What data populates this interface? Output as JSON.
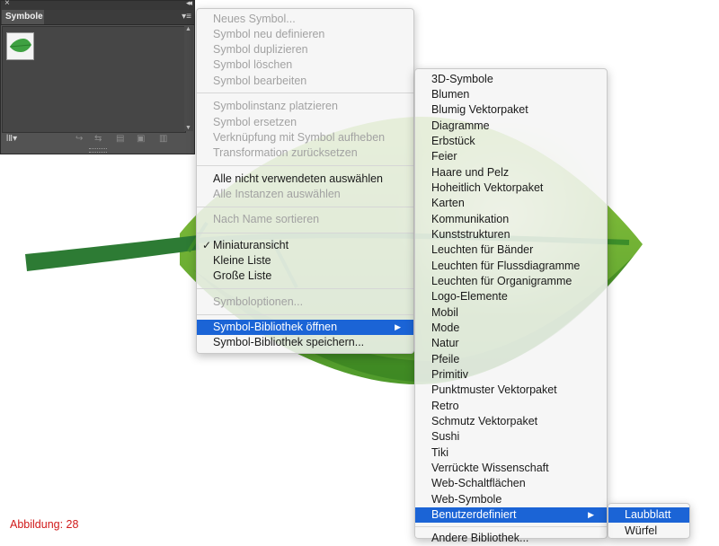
{
  "panel": {
    "tab_title": "Symbole",
    "close_glyph": "×",
    "collapse_glyph": "◂◂",
    "menu_glyph": "▾≡",
    "library_glyph": "lⅡ▾"
  },
  "context_menu": {
    "items": [
      "Neues Symbol...",
      "Symbol neu definieren",
      "Symbol duplizieren",
      "Symbol löschen",
      "Symbol bearbeiten",
      "Symbolinstanz platzieren",
      "Symbol ersetzen",
      "Verknüpfung mit Symbol aufheben",
      "Transformation zurücksetzen",
      "Alle nicht verwendeten auswählen",
      "Alle Instanzen auswählen",
      "Nach Name sortieren",
      "Miniaturansicht",
      "Kleine Liste",
      "Große Liste",
      "Symboloptionen...",
      "Symbol-Bibliothek öffnen",
      "Symbol-Bibliothek speichern..."
    ],
    "checkmark": "✓",
    "submenu_arrow": "▶"
  },
  "library_menu": {
    "items": [
      "3D-Symbole",
      "Blumen",
      "Blumig Vektorpaket",
      "Diagramme",
      "Erbstück",
      "Feier",
      "Haare und Pelz",
      "Hoheitlich Vektorpaket",
      "Karten",
      "Kommunikation",
      "Kunststrukturen",
      "Leuchten für Bänder",
      "Leuchten für Flussdiagramme",
      "Leuchten für Organigramme",
      "Logo-Elemente",
      "Mobil",
      "Mode",
      "Natur",
      "Pfeile",
      "Primitiv",
      "Punktmuster Vektorpaket",
      "Retro",
      "Schmutz Vektorpaket",
      "Sushi",
      "Tiki",
      "Verrückte Wissenschaft",
      "Web-Schaltflächen",
      "Web-Symbole",
      "Benutzerdefiniert",
      "Andere Bibliothek..."
    ]
  },
  "custom_menu": {
    "items": [
      "Laubblatt",
      "Würfel"
    ]
  },
  "caption": "Abbildung: 28",
  "colors": {
    "selection": "#1b64d6",
    "leaf_dark": "#3f8f26",
    "leaf_light": "#8cc63f",
    "caption": "#d11a1a"
  }
}
